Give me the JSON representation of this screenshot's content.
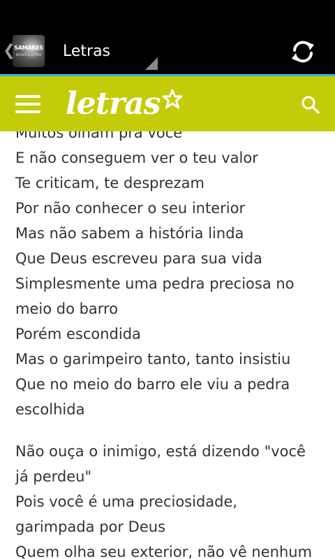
{
  "actionbar": {
    "app_icon_text": "SAMARES",
    "app_icon_subtext": "MÚSICA & LETRAS",
    "title": "Letras",
    "up_glyph": "❮",
    "refresh_icon": "refresh-icon"
  },
  "site_header": {
    "logo_text": "letras",
    "menu_icon": "hamburger-menu-icon",
    "search_icon": "search-icon"
  },
  "lyrics": {
    "stanzas": [
      {
        "lines": [
          "Muitos olham pra você",
          "E não conseguem ver o teu valor",
          "Te criticam, te desprezam",
          "Por não conhecer o seu interior",
          "Mas não sabem a história linda",
          "Que Deus escreveu para sua vida",
          "Simplesmente uma pedra preciosa no",
          "meio do barro",
          "Porém escondida",
          "Mas o garimpeiro tanto, tanto insistiu",
          "Que no meio do barro ele viu a pedra",
          "escolhida"
        ]
      },
      {
        "lines": [
          "Não ouça o inimigo, está dizendo \"você",
          "já perdeu\"",
          "Pois você é uma preciosidade,",
          "garimpada por Deus",
          "Quem olha seu exterior, não vê nenhum"
        ]
      }
    ]
  },
  "colors": {
    "header_bg": "#c4cc0a",
    "accent_line": "#33b5e5",
    "text": "#333333"
  }
}
